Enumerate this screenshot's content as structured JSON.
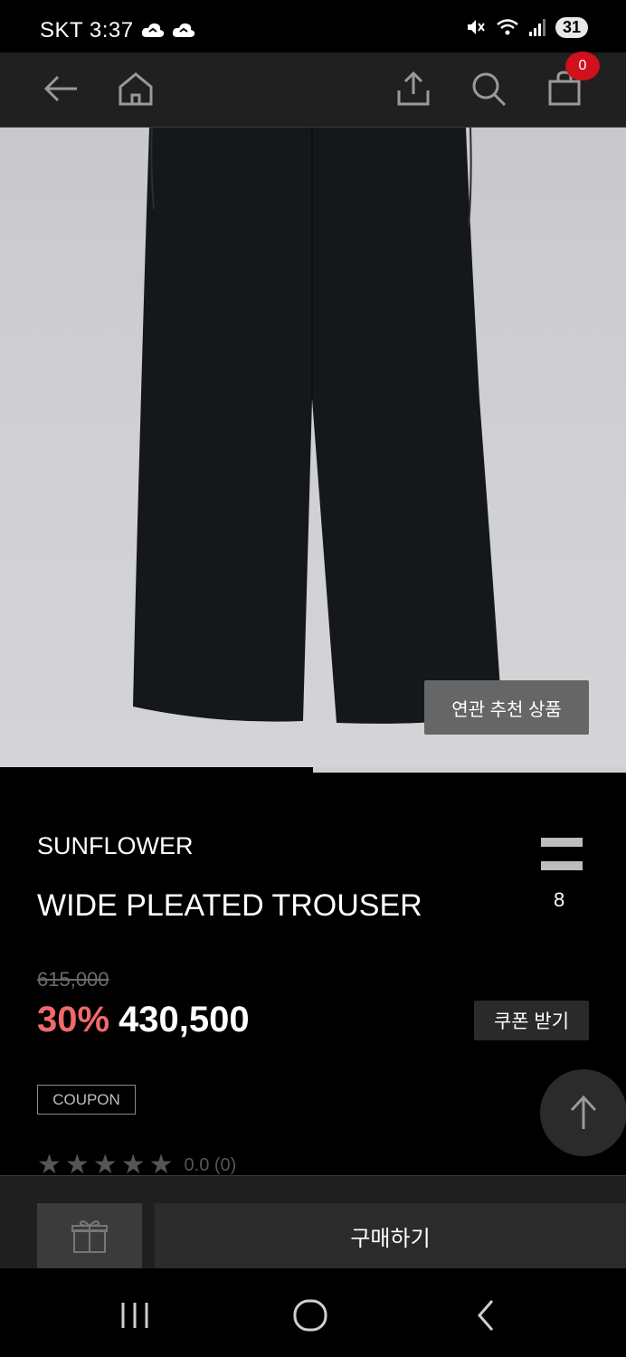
{
  "status_bar": {
    "carrier_time": "SKT 3:37",
    "battery": "31",
    "icons": [
      "cloud-icon",
      "cloud-icon",
      "mute-icon",
      "wifi-icon",
      "signal-icon"
    ]
  },
  "top_nav": {
    "icons": [
      "back-arrow-icon",
      "home-icon",
      "share-icon",
      "search-icon",
      "shopping-bag-icon"
    ],
    "cart_count": "0"
  },
  "product_image": {
    "related_button": "연관 추천 상품",
    "carousel_progress": 0.5
  },
  "product": {
    "brand": "SUNFLOWER",
    "name": "WIDE PLEATED TROUSER",
    "like_count": "8",
    "original_price": "615,000",
    "discount": "30%",
    "sale_price": "430,500",
    "coupon_button": "쿠폰 받기",
    "coupon_badge": "COUPON",
    "rating": {
      "stars": 5,
      "filled": 0,
      "text": "0.0 (0)"
    }
  },
  "bottom_bar": {
    "gift_icon": "gift-icon",
    "buy_label": "구매하기"
  },
  "system_nav": {
    "icons": [
      "recents-icon",
      "home-circle-icon",
      "back-chevron-icon"
    ]
  },
  "colors": {
    "discount": "#f06a6a",
    "badge": "#d0101a",
    "nav_background": "#202020"
  }
}
